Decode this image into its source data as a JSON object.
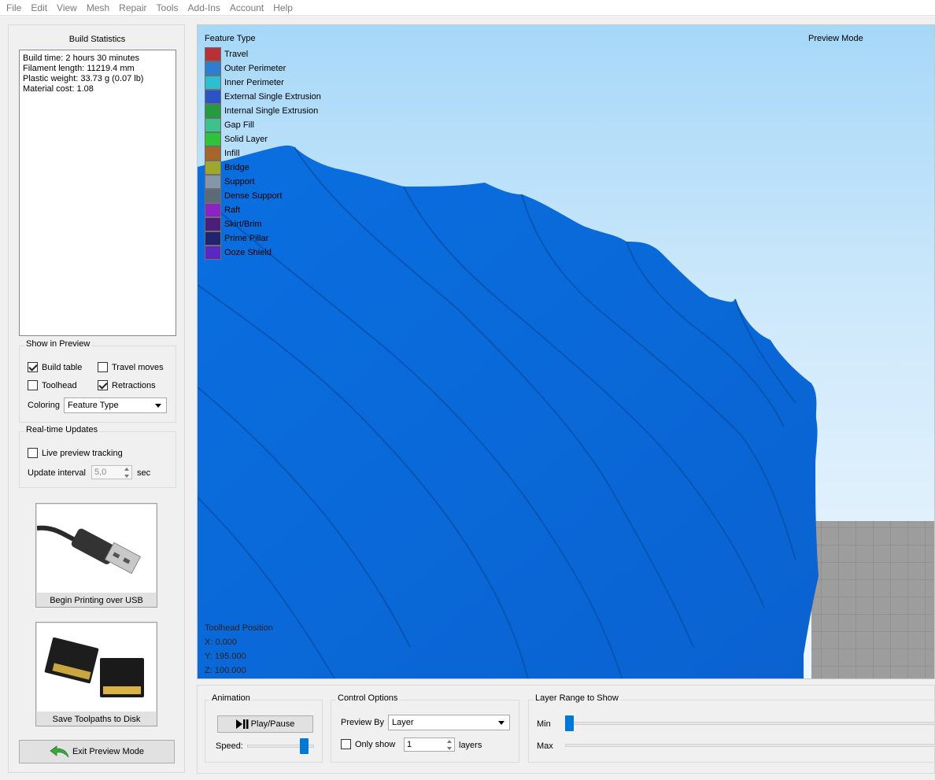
{
  "menu": [
    "File",
    "Edit",
    "View",
    "Mesh",
    "Repair",
    "Tools",
    "Add-Ins",
    "Account",
    "Help"
  ],
  "build_stats": {
    "title": "Build Statistics",
    "lines": [
      "Build time: 2 hours 30 minutes",
      "Filament length: 11219.4 mm",
      "Plastic weight: 33.73 g (0.07 lb)",
      "Material cost: 1.08"
    ]
  },
  "show_preview": {
    "title": "Show in Preview",
    "build_table": {
      "label": "Build table",
      "checked": true
    },
    "travel_moves": {
      "label": "Travel moves",
      "checked": false
    },
    "toolhead": {
      "label": "Toolhead",
      "checked": false
    },
    "retractions": {
      "label": "Retractions",
      "checked": true
    },
    "coloring_label": "Coloring",
    "coloring_value": "Feature Type"
  },
  "realtime": {
    "title": "Real-time Updates",
    "live_label": "Live preview tracking",
    "live_checked": false,
    "interval_label": "Update interval",
    "interval_value": "5,0",
    "interval_unit": "sec"
  },
  "usb_button": {
    "label": "Begin Printing over USB"
  },
  "disk_button": {
    "label": "Save Toolpaths to Disk"
  },
  "exit_button": {
    "label": "Exit Preview Mode"
  },
  "viewport": {
    "feature_type_title": "Feature Type",
    "preview_mode": "Preview Mode",
    "model_color": "#0a6fe0",
    "legend": [
      {
        "label": "Travel",
        "color": "#b93038"
      },
      {
        "label": "Outer Perimeter",
        "color": "#2c7fd0"
      },
      {
        "label": "Inner Perimeter",
        "color": "#2bbfcf"
      },
      {
        "label": "External Single Extrusion",
        "color": "#2a52c9"
      },
      {
        "label": "Internal Single Extrusion",
        "color": "#239c3f"
      },
      {
        "label": "Gap Fill",
        "color": "#3cc28c"
      },
      {
        "label": "Solid Layer",
        "color": "#2ec43a"
      },
      {
        "label": "Infill",
        "color": "#a86528"
      },
      {
        "label": "Bridge",
        "color": "#9fa72d"
      },
      {
        "label": "Support",
        "color": "#8497a8"
      },
      {
        "label": "Dense Support",
        "color": "#5d6b78"
      },
      {
        "label": "Raft",
        "color": "#8c23c4"
      },
      {
        "label": "Skirt/Brim",
        "color": "#4a1f7a"
      },
      {
        "label": "Prime Pillar",
        "color": "#1f2370"
      },
      {
        "label": "Ooze Shield",
        "color": "#5a27c5"
      }
    ],
    "toolhead": {
      "title": "Toolhead Position",
      "x": "X: 0.000",
      "y": "Y: 195.000",
      "z": "Z: 100.000"
    }
  },
  "animation": {
    "title": "Animation",
    "play_label": "Play/Pause",
    "speed_label": "Speed:",
    "speed_level": 0.85
  },
  "control": {
    "title": "Control Options",
    "preview_by_label": "Preview By",
    "preview_by_value": "Layer",
    "only_show_label": "Only show",
    "only_show_checked": false,
    "layers_value": "1",
    "layers_label": "layers"
  },
  "layer_range": {
    "title": "Layer Range to Show",
    "min_label": "Min",
    "max_label": "Max"
  }
}
